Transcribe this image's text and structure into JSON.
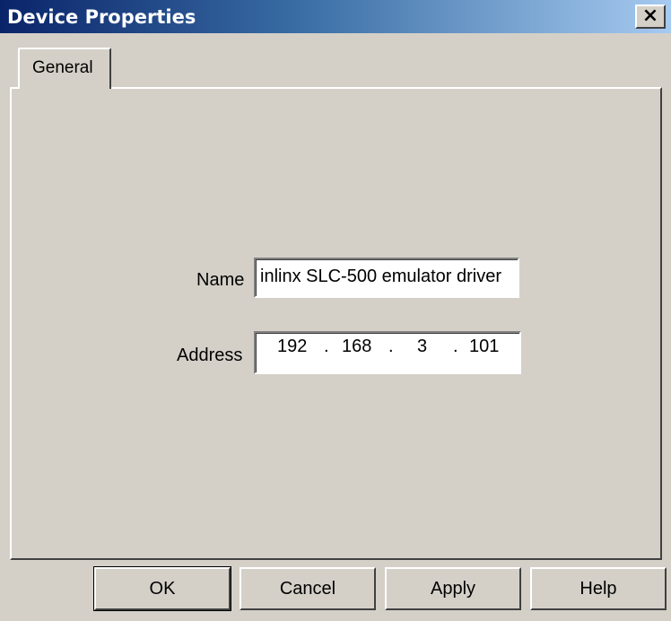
{
  "window": {
    "title": "Device Properties",
    "close_glyph": "×"
  },
  "tabs": [
    {
      "label": "General"
    }
  ],
  "form": {
    "name_label": "Name",
    "name_value": "inlinx SLC-500 emulator driver",
    "address_label": "Address",
    "address": {
      "octet1": "192",
      "octet2": "168",
      "octet3": "3",
      "octet4": "101",
      "dot": "."
    }
  },
  "buttons": {
    "ok": "OK",
    "cancel": "Cancel",
    "apply": "Apply",
    "help": "Help"
  }
}
